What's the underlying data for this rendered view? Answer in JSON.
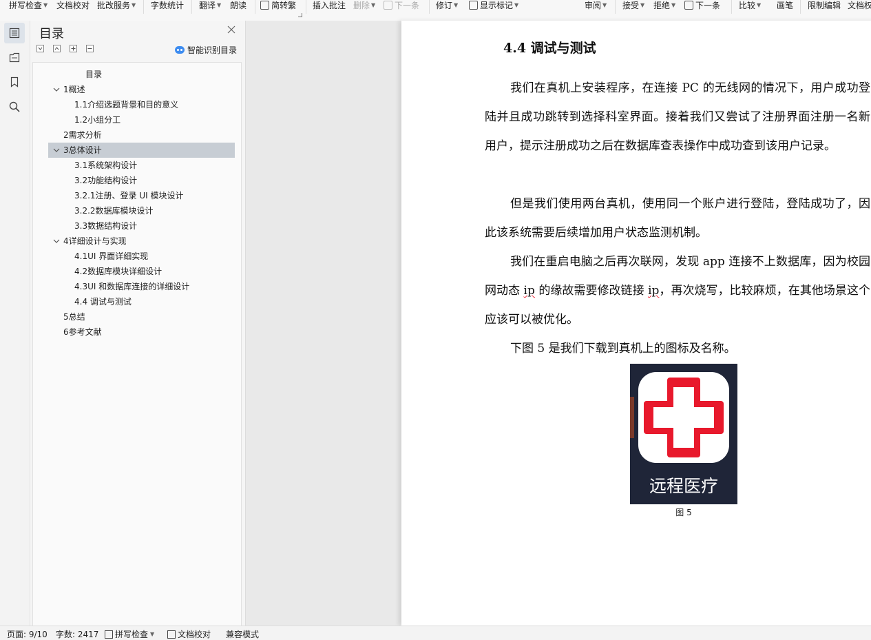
{
  "toolbar": {
    "items": [
      {
        "label": "拼写检查",
        "caret": true
      },
      {
        "label": "文档校对"
      },
      {
        "label": "批改服务",
        "caret": true
      },
      {
        "label": "字数统计"
      },
      {
        "label": "翻译",
        "caret": true
      },
      {
        "label": "朗读"
      },
      {
        "label": "简转繁"
      },
      {
        "label": "插入批注"
      },
      {
        "label": "删除",
        "caret": true,
        "disabled": true
      },
      {
        "label": "下一条",
        "disabled": true
      },
      {
        "label": "修订",
        "caret": true
      },
      {
        "label": "显示标记",
        "caret": true
      },
      {
        "label": "审阅",
        "caret": true
      },
      {
        "label": "接受",
        "caret": true
      },
      {
        "label": "拒绝",
        "caret": true
      },
      {
        "label": "下一条"
      },
      {
        "label": "比较",
        "caret": true
      },
      {
        "label": "画笔"
      },
      {
        "label": "限制编辑"
      },
      {
        "label": "文档权"
      }
    ]
  },
  "toc_panel": {
    "title": "目录",
    "smart_label": "智能识别目录",
    "items": [
      {
        "label": "目录"
      },
      {
        "label": "1概述",
        "expanded": true
      },
      {
        "label": "1.1介绍选题背景和目的意义"
      },
      {
        "label": "1.2小组分工"
      },
      {
        "label": "2需求分析"
      },
      {
        "label": "3总体设计",
        "expanded": true,
        "selected": true
      },
      {
        "label": "3.1系统架构设计"
      },
      {
        "label": "3.2功能结构设计"
      },
      {
        "label": "3.2.1注册、登录 UI 模块设计"
      },
      {
        "label": "3.2.2数据库模块设计"
      },
      {
        "label": "3.3数据结构设计"
      },
      {
        "label": "4详细设计与实现",
        "expanded": true
      },
      {
        "label": "4.1UI 界面详细实现"
      },
      {
        "label": "4.2数据库模块详细设计"
      },
      {
        "label": "4.3UI 和数据库连接的详细设计"
      },
      {
        "label": "4.4 调试与测试"
      },
      {
        "label": "5总结"
      },
      {
        "label": "6参考文献"
      }
    ]
  },
  "document": {
    "heading": "4.4 调试与测试",
    "para1": "我们在真机上安装程序，在连接 PC 的无线网的情况下，用户成功登陆并且成功跳转到选择科室界面。接着我们又尝试了注册界面注册一名新用户，提示注册成功之后在数据库查表操作中成功查到该用户记录。",
    "para2": "但是我们使用两台真机，使用同一个账户进行登陆，登陆成功了，因此该系统需要后续增加用户状态监测机制。",
    "para3": {
      "a": "我们在重启电脑之后再次联网，发现 app 连接不上数据库，因为校园网动态 ",
      "b": "ip",
      "c": " 的缘故需要修改链接 ",
      "d": "ip",
      "e": "，再次烧写，比较麻烦，在其他场景这个应该可以被优化。"
    },
    "para4": "下图 5 是我们下载到真机上的图标及名称。",
    "figure_text": "远程医疗",
    "figure_caption": "图 5"
  },
  "status_bar": {
    "page": "页面: 9/10",
    "words": "字数: 2417",
    "spell": "拼写检查",
    "proof": "文档校对",
    "compat": "兼容模式"
  },
  "colors": {
    "accent": "#3d8cf0",
    "selected": "#c7cdd4",
    "icon_red": "#e8192c"
  }
}
